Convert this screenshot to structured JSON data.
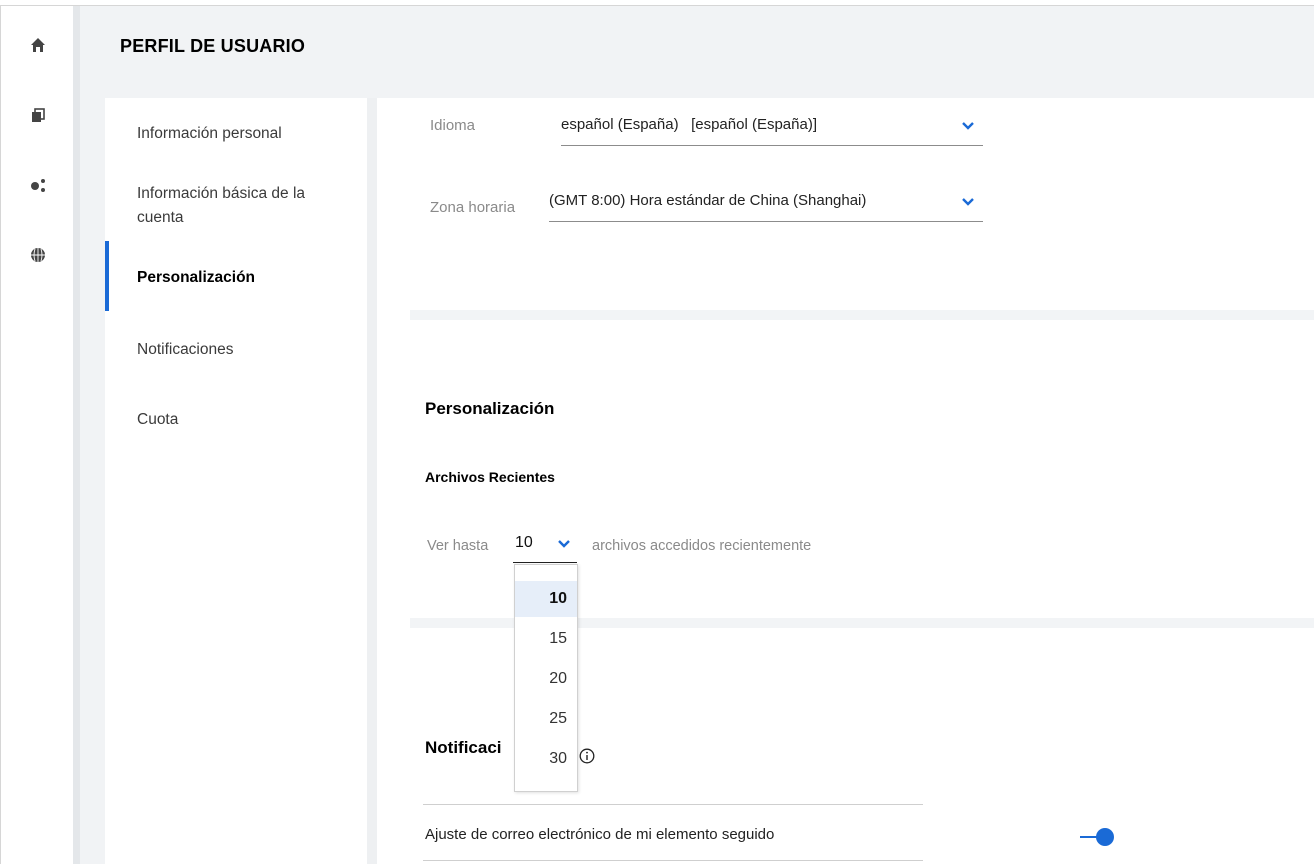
{
  "header": {
    "title": "PERFIL DE USUARIO"
  },
  "rail": {
    "icons": [
      "home-icon",
      "pages-icon",
      "share-icon",
      "globe-icon"
    ]
  },
  "subnav": {
    "items": [
      {
        "label": "Información personal"
      },
      {
        "label": "Información básica de la cuenta"
      },
      {
        "label": "Personalización",
        "active": true
      },
      {
        "label": "Notificaciones"
      },
      {
        "label": "Cuota"
      }
    ]
  },
  "locale": {
    "language_label": "Idioma",
    "language_value": "español (España)   [español (España)]",
    "timezone_label": "Zona horaria",
    "timezone_value": "(GMT 8:00) Hora estándar de China (Shanghai)"
  },
  "personalization": {
    "title": "Personalización",
    "recent_title": "Archivos Recientes",
    "prefix": "Ver hasta",
    "selected": "10",
    "suffix": "archivos accedidos recientemente",
    "options": [
      "10",
      "15",
      "20",
      "25",
      "30"
    ]
  },
  "notifications": {
    "title_visible": "Notificaci",
    "row_label": "Ajuste de correo electrónico de mi elemento seguido",
    "toggle_on": true
  },
  "colors": {
    "accent": "#1a6ad6",
    "header_bg": "#f1f3f5",
    "selected_option_bg": "#e6eef9"
  }
}
